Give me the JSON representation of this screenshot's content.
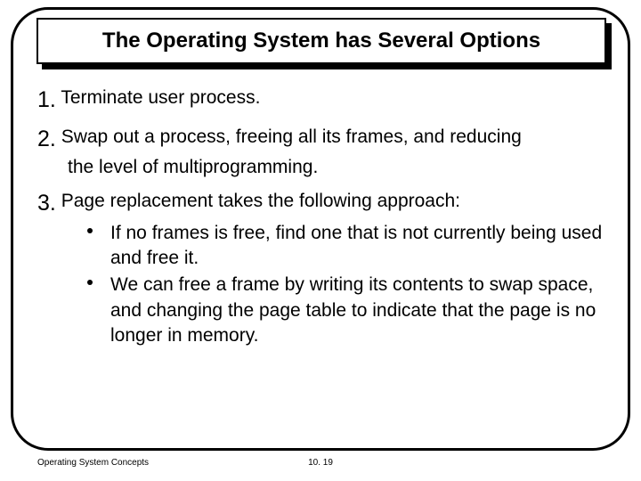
{
  "title": "The Operating System has Several Options",
  "items": {
    "n1": "1.",
    "t1": "Terminate user process.",
    "n2": "2.",
    "t2a": "Swap out a process, freeing all its frames, and reducing",
    "t2b": "the level of multiprogramming.",
    "n3": "3.",
    "t3": "Page replacement takes the following approach:",
    "s1": "If no frames is free, find one that is not currently being used and free it.",
    "s2": "We can free a frame by writing its contents to swap space, and changing the page table to indicate that the page is no longer in memory."
  },
  "footer": {
    "left": "Operating System Concepts",
    "center": "10. 19"
  }
}
